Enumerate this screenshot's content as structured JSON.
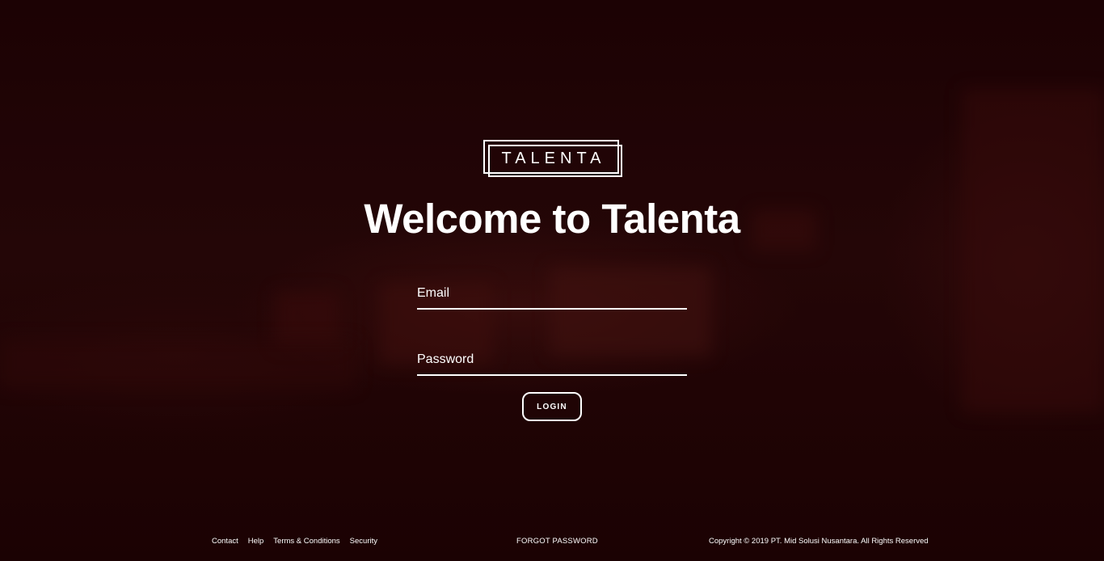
{
  "brand": {
    "logo_text": "TALENTA",
    "welcome_title": "Welcome to Talenta"
  },
  "login_form": {
    "email_placeholder": "Email",
    "email_value": "",
    "password_placeholder": "Password",
    "password_value": "",
    "login_label": "LOGIN"
  },
  "footer": {
    "links": [
      {
        "label": "Contact"
      },
      {
        "label": "Help"
      },
      {
        "label": "Terms & Conditions"
      },
      {
        "label": "Security"
      }
    ],
    "forgot_password": "FORGOT PASSWORD",
    "copyright": "Copyright © 2019 PT. Mid Solusi Nusantara. All Rights Reserved"
  },
  "colors": {
    "background": "#1e0304",
    "foreground": "#ffffff"
  }
}
